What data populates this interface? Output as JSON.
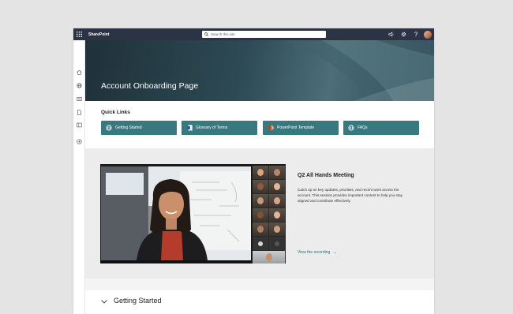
{
  "app": {
    "brand": "SharePoint"
  },
  "search": {
    "placeholder": "Search this site",
    "value": ""
  },
  "topbar": {
    "icons": [
      "megaphone-icon",
      "gear-icon",
      "help-icon"
    ],
    "avatar": "user-avatar"
  },
  "leftrail": {
    "icons": [
      "home-icon",
      "globe-icon",
      "news-icon",
      "document-icon",
      "library-icon",
      "add-circle-icon"
    ]
  },
  "hero": {
    "title": "Account Onboarding Page"
  },
  "quick_links": {
    "heading": "Quick Links",
    "items": [
      {
        "label": "Getting Started",
        "icon": "globe-icon"
      },
      {
        "label": "Glossary of Terms",
        "icon": "word-doc-icon"
      },
      {
        "label": "PowerPoint Template",
        "icon": "powerpoint-icon"
      },
      {
        "label": "FAQs",
        "icon": "globe-icon"
      }
    ]
  },
  "meeting": {
    "title": "Q2 All Hands Meeting",
    "description": "Catch up on key updates, priorities, and recent work across the account. This session provides important content to help you stay aligned and contribute effectively.",
    "link_label": "View the recording",
    "link_arrow": "→"
  },
  "getting_started": {
    "title": "Getting Started"
  },
  "colors": {
    "topbar": "#2b3345",
    "accent": "#3a7880",
    "link": "#2a6f78",
    "hero_dark": "#1f3139"
  }
}
